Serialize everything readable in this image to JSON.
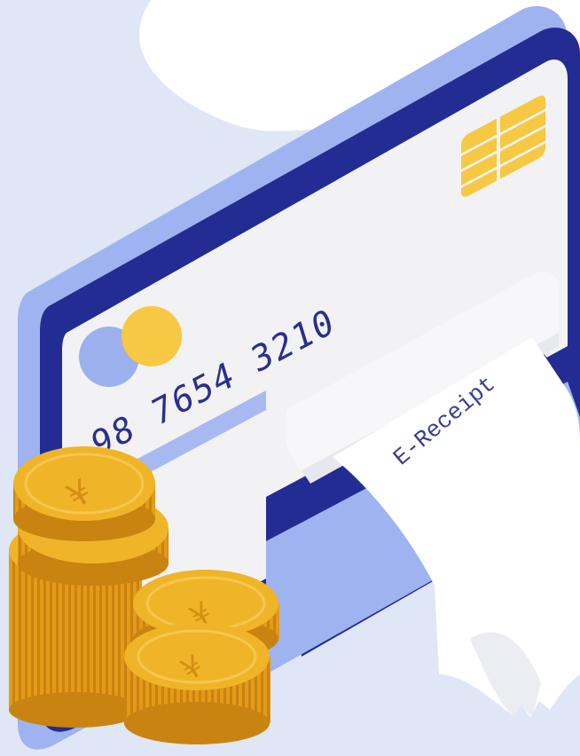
{
  "illustration": {
    "card": {
      "number_visible": "98 7654 3210"
    },
    "receipt": {
      "label": "E-Receipt"
    },
    "coin": {
      "currency_symbol": "¥"
    },
    "colors": {
      "background_blob": "#dfe6f5",
      "card_outer": "#9fb3f0",
      "card_frame": "#232c93",
      "card_face": "#f2f2f4",
      "card_stripe": "#a7b9f0",
      "chip": "#f7c843",
      "logo_blue": "#9cb0ee",
      "logo_yellow": "#f7c843",
      "slot_white": "#ffffff",
      "receipt_paper": "#ffffff",
      "coin_face": "#f0b429",
      "coin_edge": "#d58e12",
      "coin_rim": "#f6c650"
    }
  }
}
